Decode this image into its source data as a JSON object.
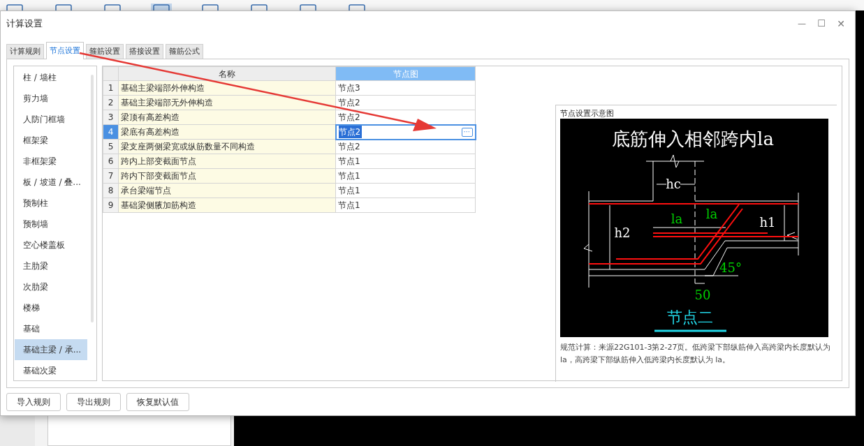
{
  "dialog": {
    "title": "计算设置"
  },
  "tabs": [
    {
      "label": "计算规则",
      "selected": false
    },
    {
      "label": "节点设置",
      "selected": true
    },
    {
      "label": "箍筋设置",
      "selected": false
    },
    {
      "label": "搭接设置",
      "selected": false
    },
    {
      "label": "箍筋公式",
      "selected": false
    }
  ],
  "sidebar": {
    "items": [
      {
        "label": "柱 / 墙柱",
        "selected": false
      },
      {
        "label": "剪力墙",
        "selected": false
      },
      {
        "label": "人防门框墙",
        "selected": false
      },
      {
        "label": "框架梁",
        "selected": false
      },
      {
        "label": "非框架梁",
        "selected": false
      },
      {
        "label": "板 / 坡道 / 叠...",
        "selected": false
      },
      {
        "label": "预制柱",
        "selected": false
      },
      {
        "label": "预制墙",
        "selected": false
      },
      {
        "label": "空心楼盖板",
        "selected": false
      },
      {
        "label": "主肋梁",
        "selected": false
      },
      {
        "label": "次肋梁",
        "selected": false
      },
      {
        "label": "楼梯",
        "selected": false
      },
      {
        "label": "基础",
        "selected": false
      },
      {
        "label": "基础主梁 / 承...",
        "selected": true
      },
      {
        "label": "基础次梁",
        "selected": false
      }
    ]
  },
  "table": {
    "columns": [
      {
        "label": "名称",
        "selected": false
      },
      {
        "label": "节点图",
        "selected": true
      }
    ],
    "rows": [
      {
        "index": "1",
        "name": "基础主梁端部外伸构造",
        "node": "节点3",
        "selected": false
      },
      {
        "index": "2",
        "name": "基础主梁端部无外伸构造",
        "node": "节点2",
        "selected": false
      },
      {
        "index": "3",
        "name": "梁顶有高差构造",
        "node": "节点2",
        "selected": false
      },
      {
        "index": "4",
        "name": "梁底有高差构造",
        "node": "节点2",
        "selected": true
      },
      {
        "index": "5",
        "name": "梁支座两侧梁宽或纵筋数量不同构造",
        "node": "节点2",
        "selected": false
      },
      {
        "index": "6",
        "name": "跨内上部变截面节点",
        "node": "节点1",
        "selected": false
      },
      {
        "index": "7",
        "name": "跨内下部变截面节点",
        "node": "节点1",
        "selected": false
      },
      {
        "index": "8",
        "name": "承台梁端节点",
        "node": "节点1",
        "selected": false
      },
      {
        "index": "9",
        "name": "基础梁侧腋加筋构造",
        "node": "节点1",
        "selected": false
      }
    ],
    "edit_button": "⋯"
  },
  "preview": {
    "title": "节点设置示意图",
    "labels": [
      {
        "text": "底筋伸入相邻跨内la",
        "kind": "title"
      },
      {
        "text": "hc",
        "kind": "dim"
      },
      {
        "text": "la",
        "kind": "length"
      },
      {
        "text": "la",
        "kind": "length"
      },
      {
        "text": "h1",
        "kind": "dim"
      },
      {
        "text": "h2",
        "kind": "dim"
      },
      {
        "text": "45°",
        "kind": "length"
      },
      {
        "text": "50",
        "kind": "length"
      },
      {
        "text": "节点二",
        "kind": "caption"
      }
    ],
    "description": "规范计算：来源22G101-3第2-27页。低跨梁下部纵筋伸入高跨梁内长度默认为 la，高跨梁下部纵筋伸入低跨梁内长度默认为 la。"
  },
  "buttons": [
    "导入规则",
    "导出规则",
    "恢复默认值"
  ],
  "window_controls": {
    "minimize": "—",
    "maximize": "☐",
    "close": "✕"
  }
}
